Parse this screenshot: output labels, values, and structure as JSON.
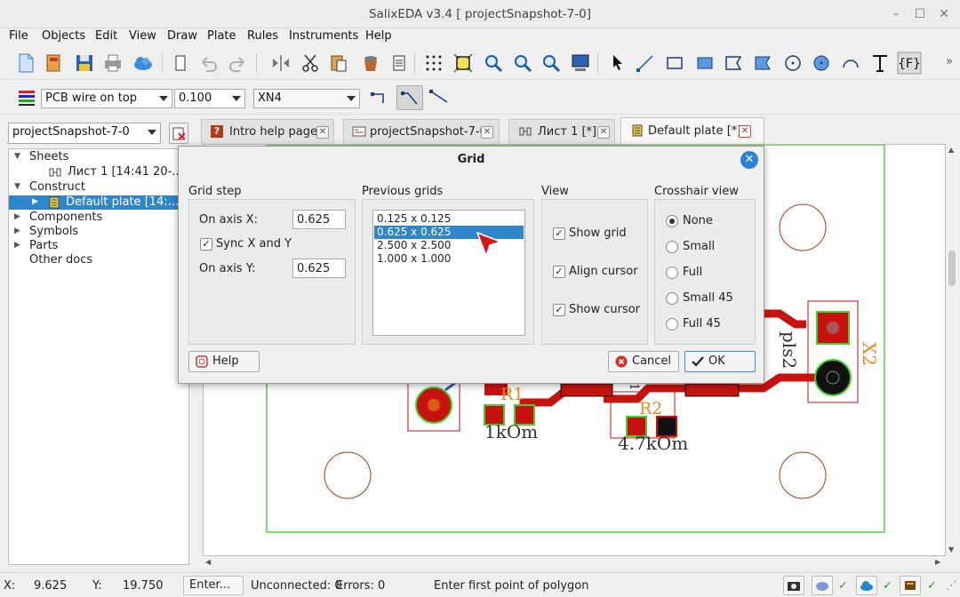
{
  "window": {
    "title": "SalixEDA v3.4 [ projectSnapshot-7-0]"
  },
  "menu": [
    "File",
    "Objects",
    "Edit",
    "View",
    "Draw",
    "Plate",
    "Rules",
    "Instruments",
    "Help"
  ],
  "toolbar2": {
    "layer": "PCB wire on top",
    "width": "0.100",
    "net": "XN4"
  },
  "project_combo": "projectSnapshot-7-0",
  "tree": [
    {
      "label": "Sheets",
      "level": 0,
      "expanded": true
    },
    {
      "label": "Лист 1 [14:41 20-...",
      "level": 2
    },
    {
      "label": "Construct",
      "level": 0,
      "expanded": true
    },
    {
      "label": "Default plate [14:...",
      "level": 1,
      "selected": true
    },
    {
      "label": "Components",
      "level": 0
    },
    {
      "label": "Symbols",
      "level": 0
    },
    {
      "label": "Parts",
      "level": 0
    },
    {
      "label": "Other docs",
      "level": 0
    }
  ],
  "tabs": [
    {
      "label": "Intro help page",
      "active": false
    },
    {
      "label": "projectSnapshot-7-0",
      "active": false
    },
    {
      "label": "Лист 1 [*]",
      "active": false
    },
    {
      "label": "Default plate [*]",
      "active": true
    }
  ],
  "pcb": {
    "labels": {
      "r1": "R1",
      "r1_val": "1kOm",
      "r2": "R2",
      "r2_val": "4.7kOm",
      "pls2": "pls2",
      "x2": "X2",
      "one": "1"
    }
  },
  "dialog": {
    "title": "Grid",
    "grid_step": {
      "label": "Grid step",
      "axis_x_label": "On axis X:",
      "axis_x_value": "0.625",
      "sync_label": "Sync X and Y",
      "sync_checked": true,
      "axis_y_label": "On axis Y:",
      "axis_y_value": "0.625"
    },
    "previous_grids": {
      "label": "Previous grids",
      "items": [
        "0.125 x 0.125",
        "0.625 x 0.625",
        "2.500 x 2.500",
        "1.000 x 1.000"
      ],
      "selected": "0.625 x 0.625"
    },
    "view": {
      "label": "View",
      "show_grid": "Show grid",
      "align_cursor": "Align cursor",
      "show_cursor": "Show cursor"
    },
    "crosshair": {
      "label": "Crosshair view",
      "options": [
        "None",
        "Small",
        "Full",
        "Small 45",
        "Full 45"
      ],
      "selected": "None"
    },
    "help_button": "Help",
    "cancel_button": "Cancel",
    "ok_button": "OK"
  },
  "status": {
    "x_label": "X:",
    "x_value": "9.625",
    "y_label": "Y:",
    "y_value": "19.750",
    "enter_button": "Enter...",
    "unconnected": "Unconnected: 0",
    "errors": "Errors: 0",
    "hint": "Enter first point of polygon"
  },
  "colors": {
    "copper": "#c8120f",
    "pad_outline": "#43d129",
    "selection": "#2f86c8",
    "accent": "#2a83d8",
    "label_orange": "#e88a1f"
  }
}
